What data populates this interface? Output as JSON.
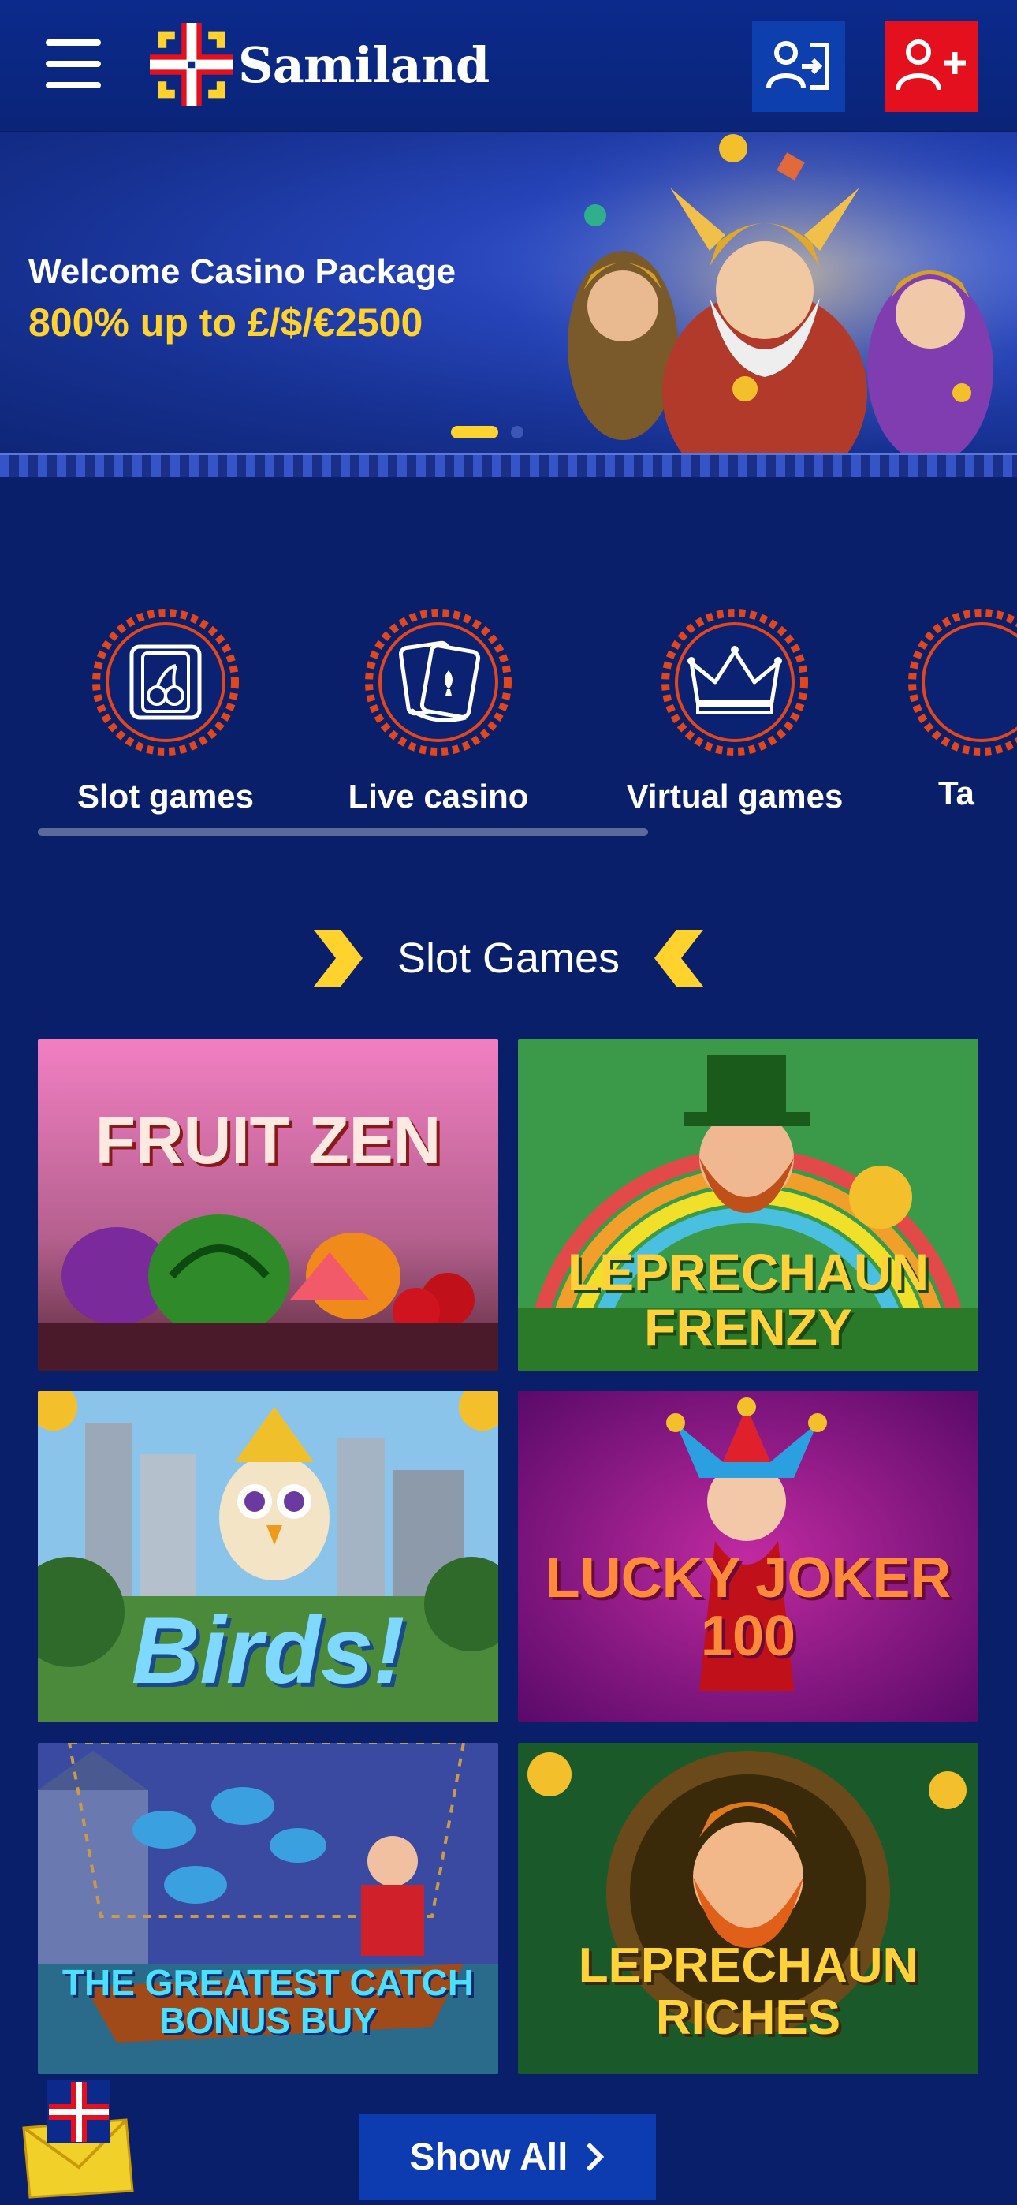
{
  "header": {
    "brand": "Samiland",
    "menu_icon": "hamburger-menu-icon",
    "login_icon": "login-icon",
    "register_icon": "add-user-icon",
    "colors": {
      "login_bg": "#0e3fae",
      "register_bg": "#e5101d"
    }
  },
  "hero": {
    "title": "Welcome Casino Package",
    "subtitle": "800% up to £/$/€2500",
    "slides_total": 2,
    "active_slide": 1
  },
  "categories": [
    {
      "label": "Slot games",
      "icon": "cherry-card-icon"
    },
    {
      "label": "Live casino",
      "icon": "playing-cards-icon"
    },
    {
      "label": "Virtual games",
      "icon": "crown-icon"
    },
    {
      "label": "Ta",
      "icon": "category-icon"
    }
  ],
  "section": {
    "title": "Slot Games"
  },
  "games": [
    {
      "name": "FRUIT ZEN"
    },
    {
      "name": "LEPRECHAUN FRENZY"
    },
    {
      "name": "Birds!"
    },
    {
      "name": "LUCKY JOKER 100"
    },
    {
      "name": "THE GREATEST CATCH BONUS BUY"
    },
    {
      "name": "LEPRECHAUN RICHES"
    }
  ],
  "show_all": {
    "label": "Show All"
  },
  "colors": {
    "accent_yellow": "#ffd22e",
    "background": "#0a1f6a"
  }
}
